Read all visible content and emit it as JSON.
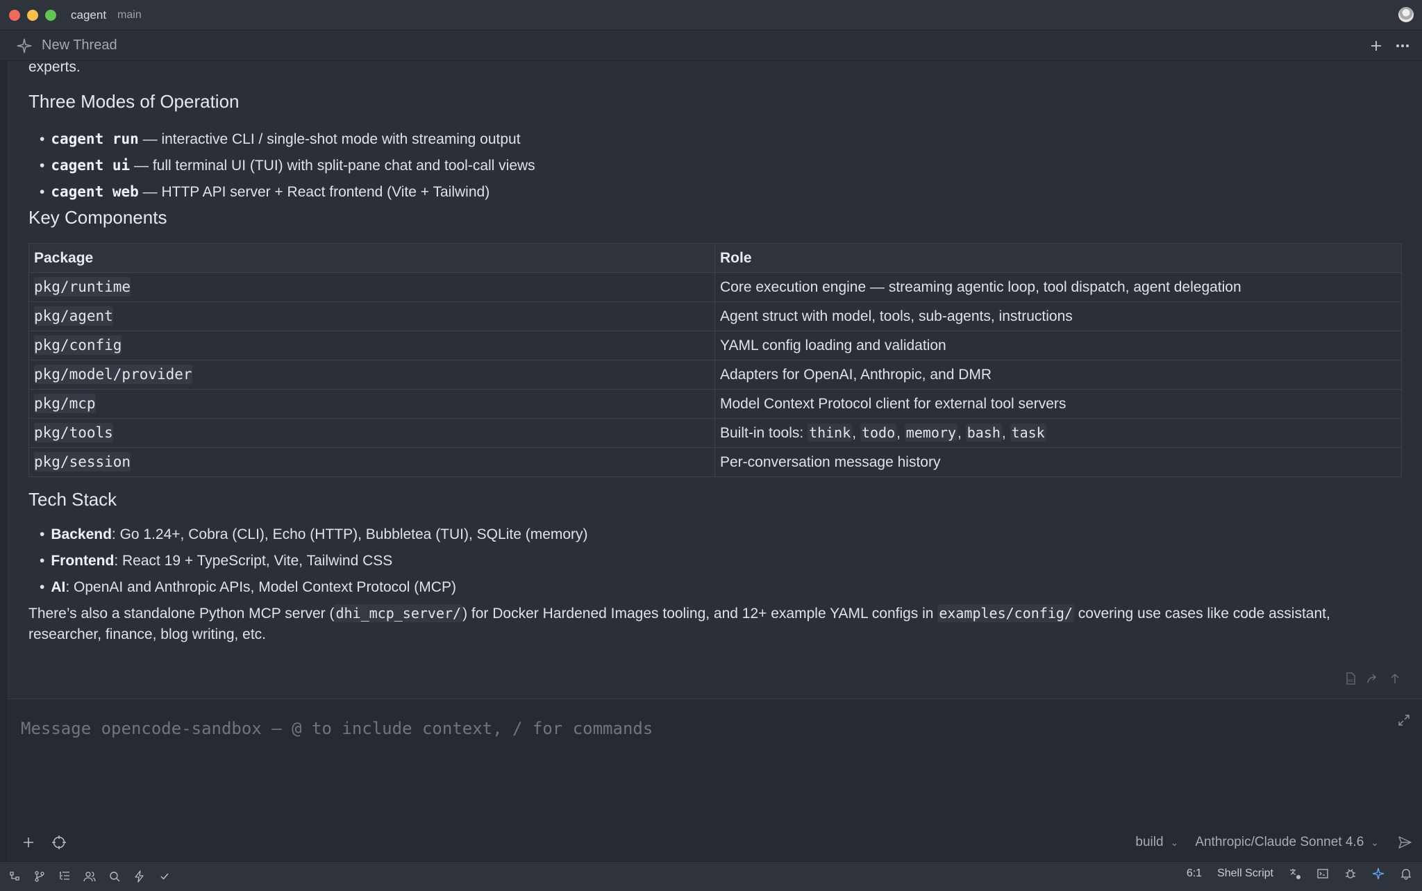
{
  "window": {
    "app": "cagent",
    "branch": "main"
  },
  "thread": {
    "title": "New Thread"
  },
  "content": {
    "intro_fragment": "experts.",
    "modes_heading": "Three Modes of Operation",
    "modes": [
      {
        "cmd": "cagent run",
        "desc": " — interactive CLI / single-shot mode with streaming output"
      },
      {
        "cmd": "cagent ui",
        "desc": " — full terminal UI (TUI) with split-pane chat and tool-call views"
      },
      {
        "cmd": "cagent web",
        "desc": " — HTTP API server + React frontend (Vite + Tailwind)"
      }
    ],
    "components_heading": "Key Components",
    "table": {
      "headers": [
        "Package",
        "Role"
      ],
      "rows": [
        {
          "pkg": "pkg/runtime",
          "role": "Core execution engine — streaming agentic loop, tool dispatch, agent delegation"
        },
        {
          "pkg": "pkg/agent",
          "role": "Agent struct with model, tools, sub-agents, instructions"
        },
        {
          "pkg": "pkg/config",
          "role": "YAML config loading and validation"
        },
        {
          "pkg": "pkg/model/provider",
          "role": "Adapters for OpenAI, Anthropic, and DMR"
        },
        {
          "pkg": "pkg/mcp",
          "role": "Model Context Protocol client for external tool servers"
        },
        {
          "pkg": "pkg/tools",
          "role_prefix": "Built-in tools: ",
          "role_codes": [
            "think",
            "todo",
            "memory",
            "bash",
            "task"
          ]
        },
        {
          "pkg": "pkg/session",
          "role": "Per-conversation message history"
        }
      ]
    },
    "tech_heading": "Tech Stack",
    "tech": [
      {
        "label": "Backend",
        "text": ": Go 1.24+, Cobra (CLI), Echo (HTTP), Bubbletea (TUI), SQLite (memory)"
      },
      {
        "label": "Frontend",
        "text": ": React 19 + TypeScript, Vite, Tailwind CSS"
      },
      {
        "label": "AI",
        "text": ": OpenAI and Anthropic APIs, Model Context Protocol (MCP)"
      }
    ],
    "closing": {
      "part1": "There’s also a standalone Python MCP server (",
      "code1": "dhi_mcp_server/",
      "part2": ") for Docker Hardened Images tooling, and 12+ example YAML configs in ",
      "code2": "examples/config/",
      "part3": " covering use cases like code assistant,",
      "line2": "researcher, finance, blog writing, etc."
    }
  },
  "composer": {
    "placeholder": "Message opencode-sandbox — @ to include context, / for commands",
    "mode": "build",
    "model": "Anthropic/Claude Sonnet 4.6"
  },
  "statusbar": {
    "cursor": "6:1",
    "language": "Shell Script"
  },
  "colors": {
    "background": "#2b2f38",
    "accent_blue": "#6aa8ff"
  }
}
